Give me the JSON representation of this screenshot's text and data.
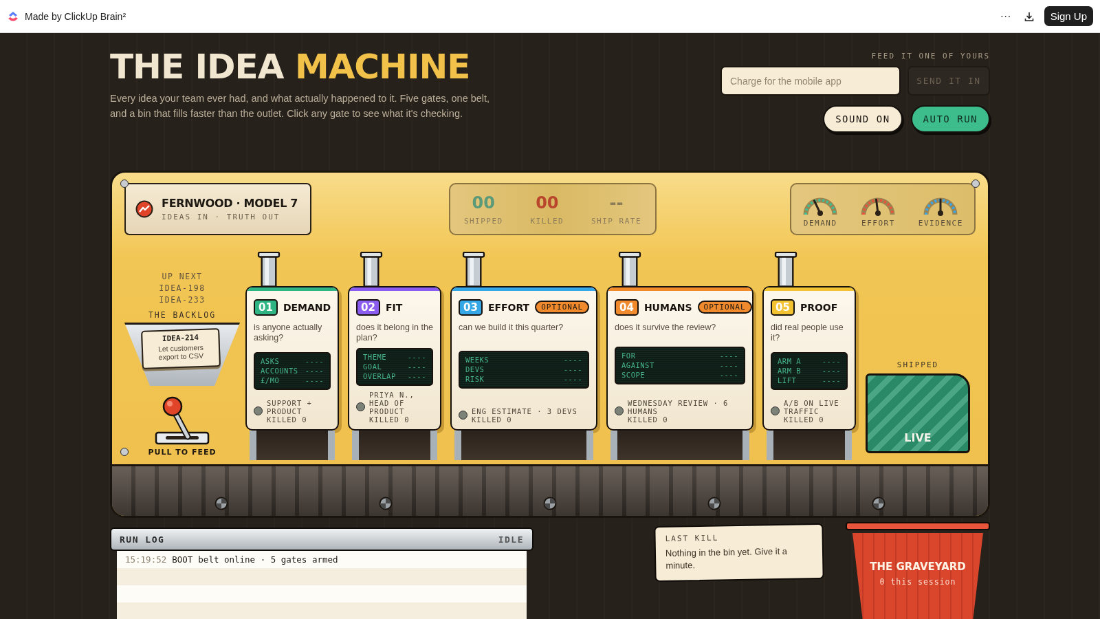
{
  "topbar": {
    "brand": "Made by ClickUp Brain²",
    "menu": "···",
    "action": "Sign Up"
  },
  "hero": {
    "title_parts": [
      {
        "text": "THE IDEA ",
        "accent": false
      },
      {
        "text": "MACHINE",
        "accent": true
      }
    ],
    "description": "Every idea your team ever had, and what actually happened to it. Five gates, one belt, and a bin that fills faster than the outlet. Click any gate to see what it's checking.",
    "feed_label": "FEED IT ONE OF YOURS",
    "idea_input": {
      "placeholder": "Charge for the mobile app"
    },
    "send_button": {
      "label": "SEND IT IN",
      "disabled": true
    },
    "toggles": [
      {
        "label": "SOUND ON",
        "on": false
      },
      {
        "label": "AUTO RUN",
        "on": true
      }
    ]
  },
  "machine": {
    "nameplate": {
      "title": "FERNWOOD · MODEL 7",
      "subtitle": "IDEAS IN · TRUTH OUT"
    },
    "counters": [
      {
        "value": "00",
        "label": "SHIPPED",
        "color": "#5b9a78"
      },
      {
        "value": "00",
        "label": "KILLED",
        "color": "#b8452c"
      },
      {
        "value": "--",
        "label": "SHIP RATE",
        "color": "#8c7b58"
      }
    ],
    "gauges": [
      {
        "label": "DEMAND",
        "level": 0.36,
        "color": "#3fbf94"
      },
      {
        "label": "EFFORT",
        "level": 0.46,
        "color": "#e8553a"
      },
      {
        "label": "EVIDENCE",
        "level": 0.5,
        "color": "#3aa6e8"
      }
    ],
    "backlog": {
      "up_next_label": "UP NEXT",
      "queue": [
        "IDEA-198",
        "IDEA-233"
      ],
      "title": "THE BACKLOG",
      "card": {
        "id": "IDEA-214",
        "text": "Let customers export to CSV"
      },
      "lever_label": "PULL TO FEED"
    },
    "gates": [
      {
        "number": "01",
        "name": "DEMAND",
        "color": "#2fb584",
        "question": "is anyone actually asking?",
        "readout": [
          {
            "label": "ASKS",
            "value": "----"
          },
          {
            "label": "ACCOUNTS",
            "value": "----"
          },
          {
            "label": "£/MO",
            "value": "----"
          }
        ],
        "source": "SUPPORT + PRODUCT",
        "killed": "KILLED 0"
      },
      {
        "number": "02",
        "name": "FIT",
        "color": "#8b5cf0",
        "question": "does it belong in the plan?",
        "readout": [
          {
            "label": "THEME",
            "value": "----"
          },
          {
            "label": "GOAL",
            "value": "----"
          },
          {
            "label": "OVERLAP",
            "value": "----"
          }
        ],
        "source": "PRIYA N., HEAD OF PRODUCT",
        "killed": "KILLED 0"
      },
      {
        "number": "03",
        "name": "EFFORT",
        "color": "#35a7e6",
        "tag": "OPTIONAL",
        "question": "can we build it this quarter?",
        "readout": [
          {
            "label": "WEEKS",
            "value": "----"
          },
          {
            "label": "DEVS",
            "value": "----"
          },
          {
            "label": "RISK",
            "value": "----"
          }
        ],
        "source": "ENG ESTIMATE · 3 DEVS",
        "killed": "KILLED 0"
      },
      {
        "number": "04",
        "name": "HUMANS",
        "color": "#f08a2c",
        "tag": "OPTIONAL",
        "question": "does it survive the review?",
        "readout": [
          {
            "label": "FOR",
            "value": "----"
          },
          {
            "label": "AGAINST",
            "value": "----"
          },
          {
            "label": "SCOPE",
            "value": "----"
          }
        ],
        "source": "WEDNESDAY REVIEW · 6 HUMANS",
        "killed": "KILLED 0"
      },
      {
        "number": "05",
        "name": "PROOF",
        "color": "#f2c230",
        "question": "did real people use it?",
        "readout": [
          {
            "label": "ARM A",
            "value": "----"
          },
          {
            "label": "ARM B",
            "value": "----"
          },
          {
            "label": "LIFT",
            "value": "----"
          }
        ],
        "source": "A/B ON LIVE TRAFFIC",
        "killed": "KILLED 0"
      }
    ],
    "shipped": {
      "label": "SHIPPED",
      "bin_label": "LIVE"
    }
  },
  "run_log": {
    "title": "RUN LOG",
    "status": "IDLE",
    "entries": [
      {
        "time": "15:19:52",
        "tag": "BOOT",
        "message": "belt online · 5 gates armed"
      }
    ]
  },
  "last_kill": {
    "label": "LAST KILL",
    "text": "Nothing in the bin yet. Give it a minute."
  },
  "graveyard": {
    "title": "THE GRAVEYARD",
    "count": "0 this session"
  }
}
